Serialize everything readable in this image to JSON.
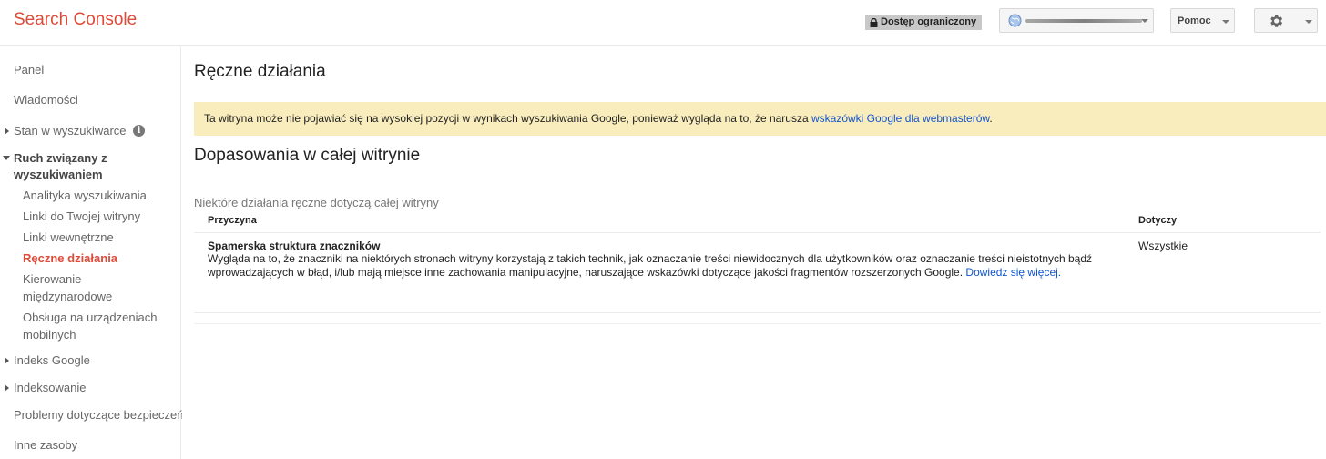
{
  "header": {
    "app_title": "Search Console",
    "restricted_label": "Dostęp ograniczony",
    "help_label": "Pomoc"
  },
  "sidebar": {
    "panel": "Panel",
    "messages": "Wiadomości",
    "search_appearance": "Stan w wyszukiwarce",
    "search_traffic": "Ruch związany z wyszukiwaniem",
    "search_analytics": "Analityka wyszukiwania",
    "links_to_site": "Linki do Twojej witryny",
    "internal_links": "Linki wewnętrzne",
    "manual_actions": "Ręczne działania",
    "intl_targeting_1": "Kierowanie",
    "intl_targeting_2": "międzynarodowe",
    "mobile_1": "Obsługa na urządzeniach",
    "mobile_2": "mobilnych",
    "google_index": "Indeks Google",
    "crawl": "Indeksowanie",
    "security": "Problemy dotyczące bezpieczeństwa",
    "other_resources": "Inne zasoby",
    "info_glyph": "i"
  },
  "main": {
    "title": "Ręczne działania",
    "warning_text": "Ta witryna może nie pojawiać się na wysokiej pozycji w wynikach wyszukiwania Google, ponieważ wygląda na to, że narusza ",
    "warning_link": "wskazówki Google dla webmasterów",
    "warning_end": ".",
    "section_title": "Dopasowania w całej witrynie",
    "section_subtitle": "Niektóre działania ręczne dotyczą całej witryny",
    "table": {
      "col_reason": "Przyczyna",
      "col_applies": "Dotyczy",
      "rows": [
        {
          "title": "Spamerska struktura znaczników",
          "description": "Wygląda na to, że znaczniki na niektórych stronach witryny korzystają z takich technik, jak oznaczanie treści niewidocznych dla użytkowników oraz oznaczanie treści nieistotnych bądź wprowadzających w błąd, i/lub mają miejsce inne zachowania manipulacyjne, naruszające wskazówki dotyczące jakości fragmentów rozszerzonych Google. ",
          "link": "Dowiedz się więcej.",
          "applies": "Wszystkie"
        }
      ]
    }
  },
  "colors": {
    "brand_red": "#dd4b39",
    "link_blue": "#1155cc",
    "warning_bg": "#f9edbe"
  }
}
